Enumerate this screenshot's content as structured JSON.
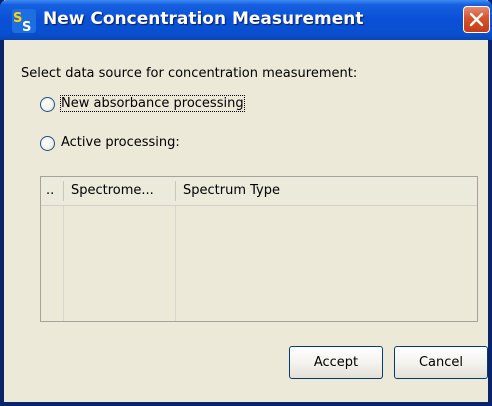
{
  "window": {
    "title": "New Concentration Measurement"
  },
  "dialog": {
    "prompt": "Select data source for concentration measurement:",
    "options": [
      {
        "label": "New absorbance processing",
        "selected": false
      },
      {
        "label": "Active processing:",
        "selected": false
      }
    ],
    "table": {
      "columns": [
        "..",
        "Spectrome...",
        "Spectrum Type"
      ],
      "rows": []
    },
    "buttons": {
      "accept": "Accept",
      "cancel": "Cancel"
    }
  },
  "colors": {
    "titlebar": "#0a4fd6",
    "close_button": "#d5532c",
    "window_bg": "#ece9d8"
  },
  "icons": {
    "app": "spectrasuite-ss-icon",
    "close": "close-x-icon"
  }
}
